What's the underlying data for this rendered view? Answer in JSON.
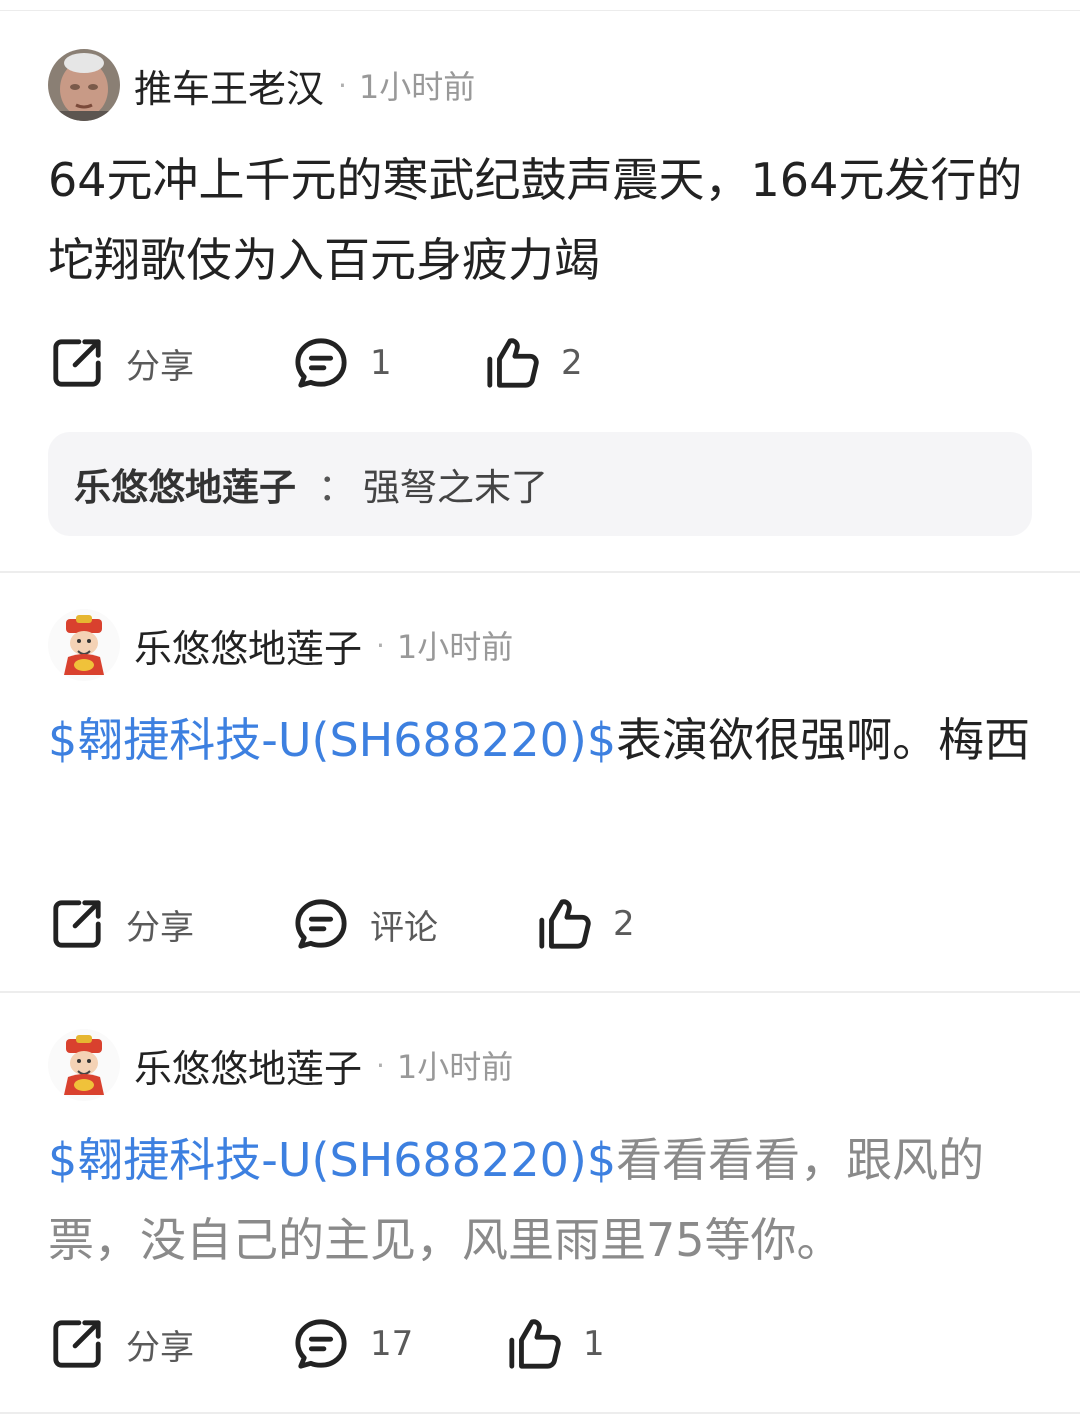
{
  "colors": {
    "ticker_link": "#3d80e0",
    "divider": "#ededed",
    "comment_box_bg": "#f5f5f7",
    "muted_text": "#999999"
  },
  "posts": [
    {
      "author": "推车王老汉",
      "separator": "·",
      "time": "1小时前",
      "avatar_icon": "elderly-man-photo-avatar",
      "text_parts": [
        "64元冲上千元的寒武纪鼓声震天，164元发行的坨翔歌伎为入百元身疲力竭"
      ],
      "actions": {
        "share_label": "分享",
        "comment_label": "1",
        "like_label": "2"
      },
      "reply": {
        "user": "乐悠悠地莲子",
        "separator": "：",
        "text": "强弩之末了"
      }
    },
    {
      "author": "乐悠悠地莲子",
      "separator": "·",
      "time": "1小时前",
      "avatar_icon": "god-of-wealth-avatar",
      "text_parts": [
        "$翱捷科技-U(SH688220)$",
        "表演欲很强啊。梅西"
      ],
      "actions": {
        "share_label": "分享",
        "comment_label": "评论",
        "like_label": "2"
      }
    },
    {
      "author": "乐悠悠地莲子",
      "separator": "·",
      "time": "1小时前",
      "avatar_icon": "god-of-wealth-avatar",
      "text_parts": [
        "$翱捷科技-U(SH688220)$",
        "看看看看，跟风的票，没自己的主见，风里雨里75等你。"
      ],
      "actions": {
        "share_label": "分享",
        "comment_label": "17",
        "like_label": "1"
      }
    }
  ]
}
